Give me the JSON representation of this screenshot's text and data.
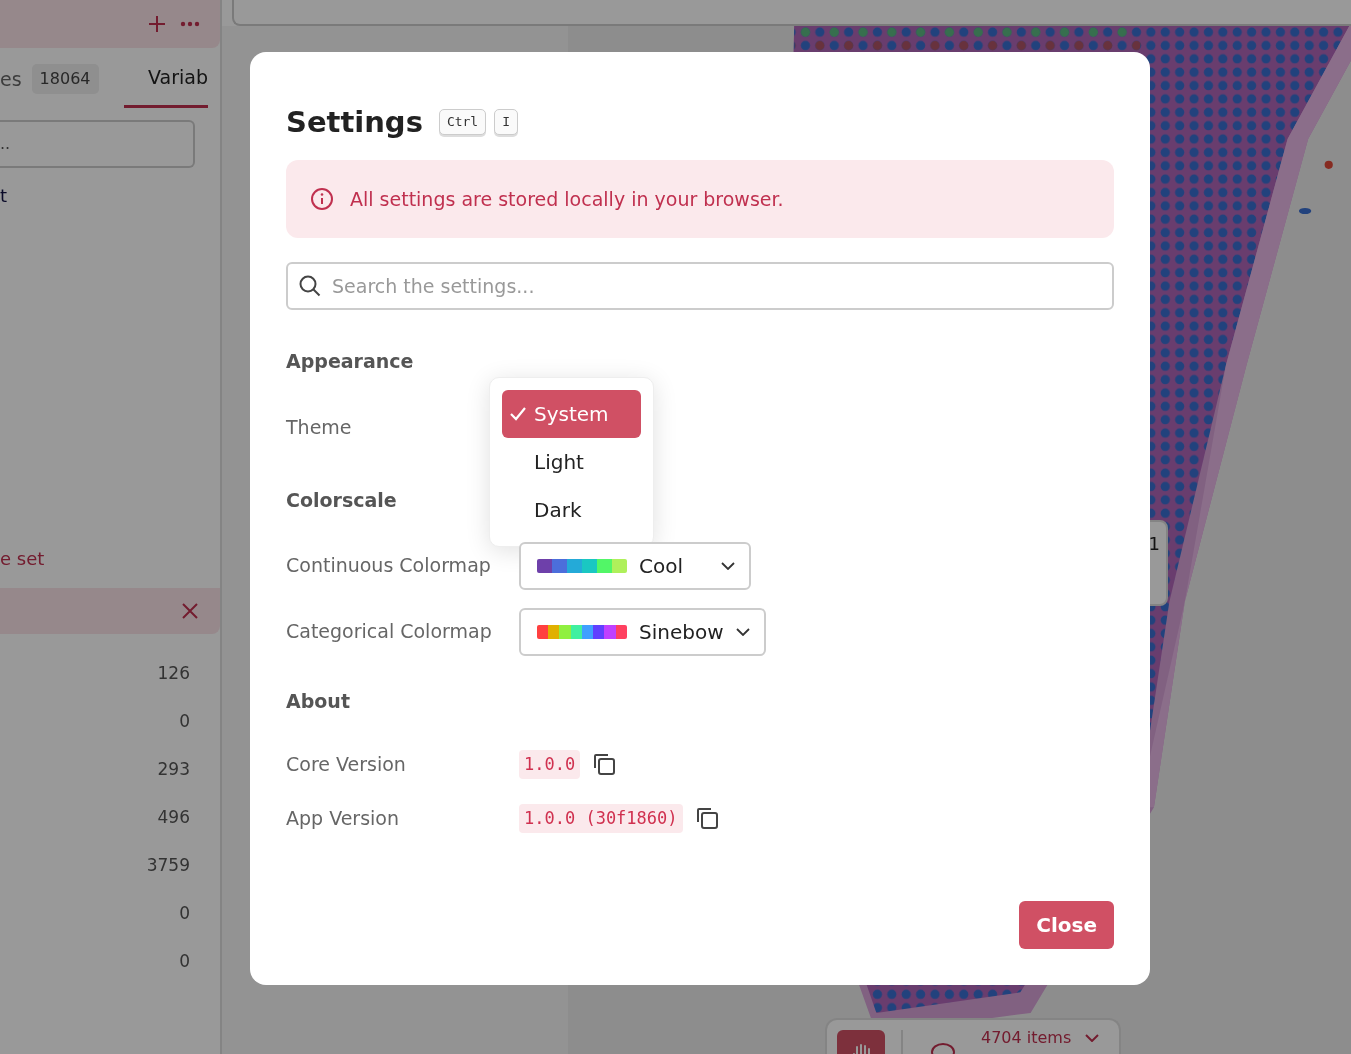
{
  "sidebar": {
    "tabs": [
      {
        "label": "es",
        "count": "18064",
        "selected": false
      },
      {
        "label": "Variab",
        "selected": true
      }
    ],
    "search": {
      "placeholder": ".."
    },
    "link": "t",
    "action": "e set",
    "counts": [
      "126",
      "0",
      "293",
      "496",
      "3759",
      "0",
      "0"
    ]
  },
  "viewer": {
    "legend": "1",
    "tools": [
      {
        "kind": "pan",
        "selected": true
      },
      {
        "kind": "lasso",
        "selected": false
      }
    ],
    "selection": "4704 items"
  },
  "dialog": {
    "title": "Settings",
    "shortcut": [
      "Ctrl",
      "I"
    ],
    "notice": "All settings are stored locally in your browser.",
    "search": {
      "placeholder": "Search the settings..."
    },
    "sections": [
      {
        "title": "Appearance",
        "rows": [
          {
            "kind": "menu",
            "label": "Theme",
            "options": [
              {
                "label": "System",
                "selected": true
              },
              {
                "label": "Light",
                "selected": false
              },
              {
                "label": "Dark",
                "selected": false
              }
            ]
          }
        ]
      },
      {
        "title": "Colorscale",
        "rows": [
          {
            "kind": "sequential",
            "label": "Continuous Colormap",
            "value": "Cool"
          },
          {
            "kind": "cyclic",
            "label": "Categorical Colormap",
            "value": "Sinebow"
          }
        ]
      },
      {
        "title": "About",
        "rows": [
          {
            "kind": "version",
            "label": "Core Version",
            "value": "1.0.0"
          },
          {
            "kind": "version",
            "label": "App Version",
            "value": "1.0.0 (30f1860)"
          }
        ]
      }
    ],
    "close": "Close"
  }
}
